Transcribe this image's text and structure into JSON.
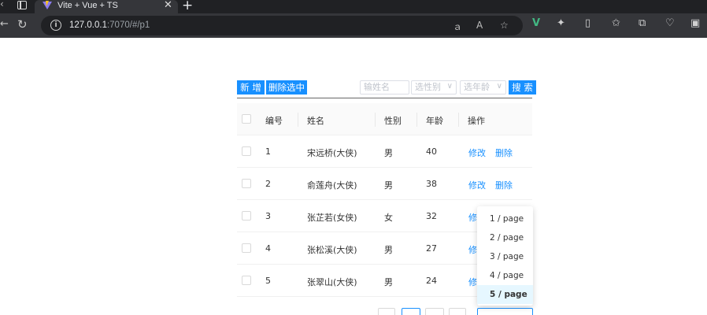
{
  "browser": {
    "tab_title": "Vite + Vue + TS",
    "tab_close": "✕",
    "new_tab": "+",
    "url_host": "127.0.0.1",
    "url_rest": ":7070/#/p1"
  },
  "toolbar": {
    "add_label": "新 增",
    "delete_selected_label": "删除选中",
    "name_placeholder": "输姓名",
    "gender_placeholder": "选性别",
    "age_placeholder": "选年龄",
    "search_label": "搜 索"
  },
  "table": {
    "columns": [
      "编号",
      "姓名",
      "性别",
      "年龄",
      "操作"
    ],
    "rows": [
      {
        "id": "1",
        "name": "宋远桥(大侠)",
        "gender": "男",
        "age": "40",
        "edit": "修改",
        "delete": "删除"
      },
      {
        "id": "2",
        "name": "俞莲舟(大侠)",
        "gender": "男",
        "age": "38",
        "edit": "修改",
        "delete": "删除"
      },
      {
        "id": "3",
        "name": "张芷若(女侠)",
        "gender": "女",
        "age": "32",
        "edit": "修",
        "delete": ""
      },
      {
        "id": "4",
        "name": "张松溪(大侠)",
        "gender": "男",
        "age": "27",
        "edit": "修",
        "delete": ""
      },
      {
        "id": "5",
        "name": "张翠山(大侠)",
        "gender": "男",
        "age": "24",
        "edit": "修",
        "delete": ""
      }
    ]
  },
  "page_size_options": [
    "1 / page",
    "2 / page",
    "3 / page",
    "4 / page",
    "5 / page"
  ],
  "page_size_selected": "5 / page",
  "colors": {
    "primary": "#1890ff",
    "selected_bg": "#e6f7ff",
    "header_bg": "#fafafa",
    "chrome_dark": "#202124",
    "chrome_mid": "#35363a"
  }
}
